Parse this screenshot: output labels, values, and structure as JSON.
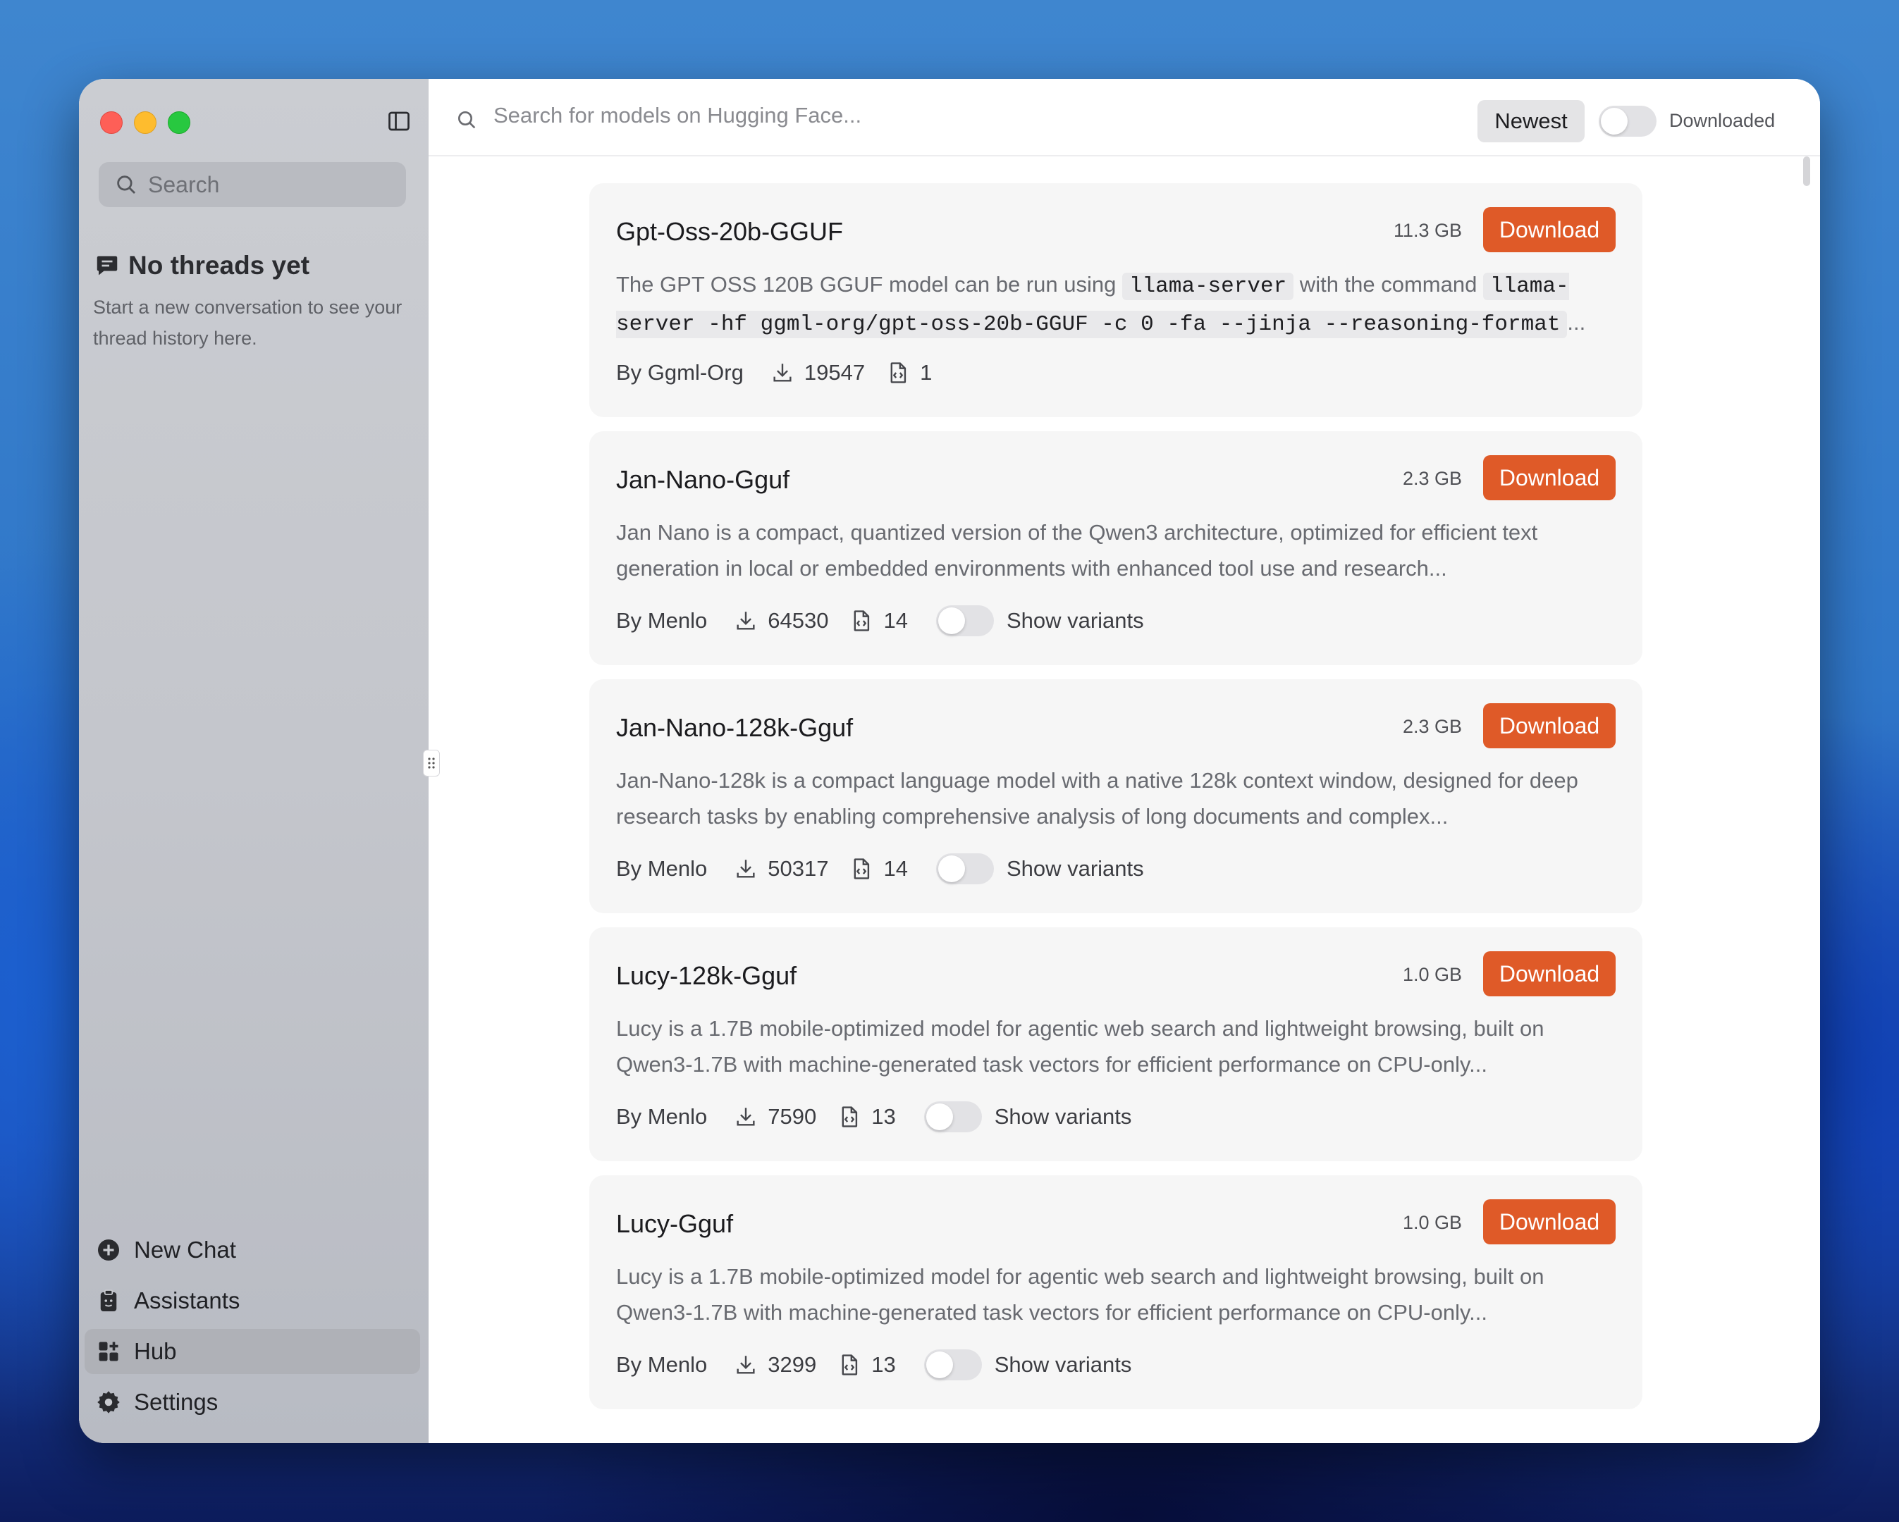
{
  "sidebar": {
    "search_placeholder": "Search",
    "empty_title": "No threads yet",
    "empty_desc": "Start a new conversation to see your thread history here.",
    "nav": [
      {
        "label": "New Chat",
        "icon": "plus-circle-icon",
        "active": false
      },
      {
        "label": "Assistants",
        "icon": "clipboard-icon",
        "active": false
      },
      {
        "label": "Hub",
        "icon": "grid-plus-icon",
        "active": true
      },
      {
        "label": "Settings",
        "icon": "gear-icon",
        "active": false
      }
    ]
  },
  "topbar": {
    "search_placeholder": "Search for models on Hugging Face...",
    "sort_label": "Newest",
    "downloaded_label": "Downloaded",
    "downloaded_toggle": false
  },
  "models": [
    {
      "name": "Gpt-Oss-20b-GGUF",
      "size": "11.3 GB",
      "download_label": "Download",
      "desc_parts": [
        {
          "text": "The GPT OSS 120B GGUF model can be run using "
        },
        {
          "code": "llama-server"
        },
        {
          "text": " with the command "
        },
        {
          "code": "llama-server -hf ggml-org/gpt-oss-20b-GGUF -c 0 -fa --jinja --reasoning-format"
        },
        {
          "text": "..."
        }
      ],
      "author": "By Ggml-Org",
      "downloads": "19547",
      "files": "1",
      "show_variants": false
    },
    {
      "name": "Jan-Nano-Gguf",
      "size": "2.3 GB",
      "download_label": "Download",
      "desc": "Jan Nano is a compact, quantized version of the Qwen3 architecture, optimized for efficient text generation in local or embedded environments with enhanced tool use and research...",
      "author": "By Menlo",
      "downloads": "64530",
      "files": "14",
      "show_variants": true,
      "variants_label": "Show variants"
    },
    {
      "name": "Jan-Nano-128k-Gguf",
      "size": "2.3 GB",
      "download_label": "Download",
      "desc": "Jan-Nano-128k is a compact language model with a native 128k context window, designed for deep research tasks by enabling comprehensive analysis of long documents and complex...",
      "author": "By Menlo",
      "downloads": "50317",
      "files": "14",
      "show_variants": true,
      "variants_label": "Show variants"
    },
    {
      "name": "Lucy-128k-Gguf",
      "size": "1.0 GB",
      "download_label": "Download",
      "desc": "Lucy is a 1.7B mobile-optimized model for agentic web search and lightweight browsing, built on Qwen3-1.7B with machine-generated task vectors for efficient performance on CPU-only...",
      "author": "By Menlo",
      "downloads": "7590",
      "files": "13",
      "show_variants": true,
      "variants_label": "Show variants"
    },
    {
      "name": "Lucy-Gguf",
      "size": "1.0 GB",
      "download_label": "Download",
      "desc": "Lucy is a 1.7B mobile-optimized model for agentic web search and lightweight browsing, built on Qwen3-1.7B with machine-generated task vectors for efficient performance on CPU-only...",
      "author": "By Menlo",
      "downloads": "3299",
      "files": "13",
      "show_variants": true,
      "variants_label": "Show variants"
    }
  ],
  "colors": {
    "accent": "#df5a28",
    "card_bg": "#f6f6f6",
    "sidebar_active": "#afb1b7"
  }
}
